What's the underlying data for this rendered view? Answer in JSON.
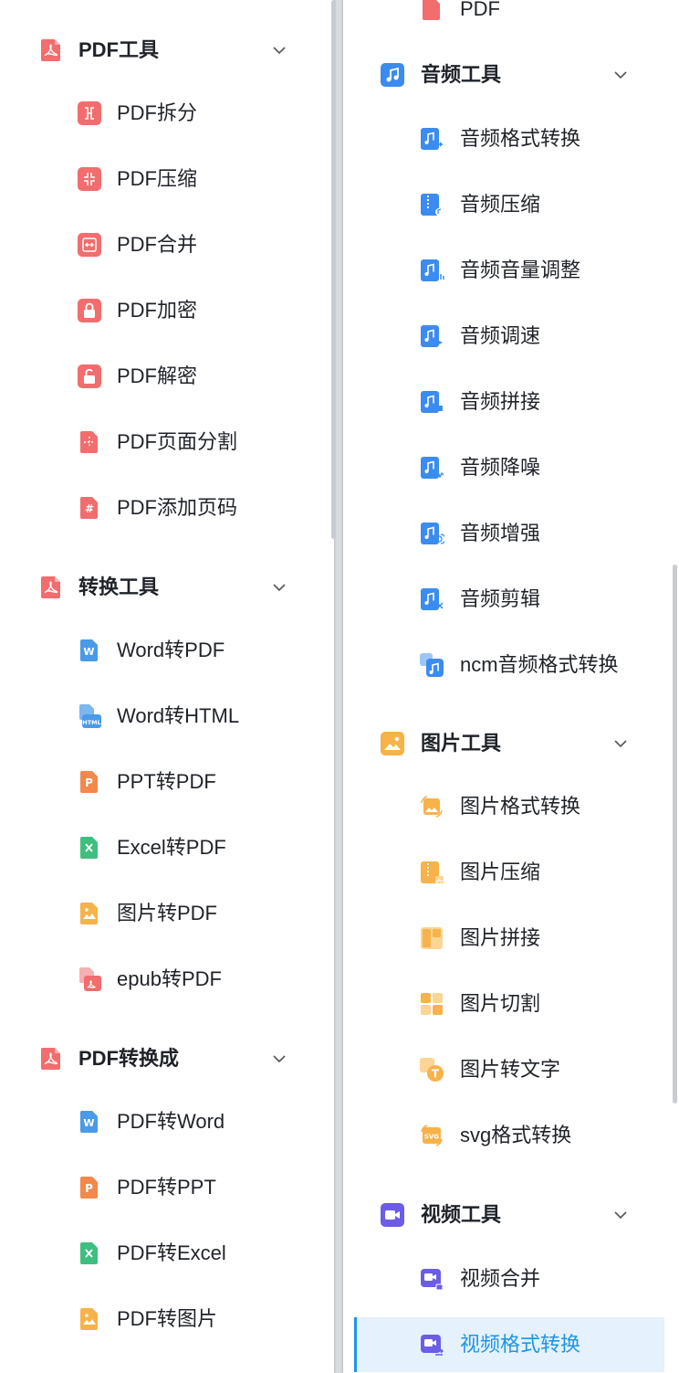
{
  "left_panel": {
    "groups": [
      {
        "title": "PDF工具",
        "icon": "pdf-icon",
        "items": [
          {
            "label": "PDF拆分",
            "icon": "pdf-split-icon"
          },
          {
            "label": "PDF压缩",
            "icon": "pdf-compress-icon"
          },
          {
            "label": "PDF合并",
            "icon": "pdf-merge-icon"
          },
          {
            "label": "PDF加密",
            "icon": "pdf-lock-icon"
          },
          {
            "label": "PDF解密",
            "icon": "pdf-unlock-icon"
          },
          {
            "label": "PDF页面分割",
            "icon": "pdf-page-split-icon"
          },
          {
            "label": "PDF添加页码",
            "icon": "pdf-page-number-icon"
          }
        ]
      },
      {
        "title": "转换工具",
        "icon": "convert-tools-icon",
        "items": [
          {
            "label": "Word转PDF",
            "icon": "word-doc-icon"
          },
          {
            "label": "Word转HTML",
            "icon": "word-html-icon"
          },
          {
            "label": "PPT转PDF",
            "icon": "ppt-doc-icon"
          },
          {
            "label": "Excel转PDF",
            "icon": "excel-doc-icon"
          },
          {
            "label": "图片转PDF",
            "icon": "image-doc-icon"
          },
          {
            "label": "epub转PDF",
            "icon": "epub-pdf-icon"
          }
        ]
      },
      {
        "title": "PDF转换成",
        "icon": "pdf-convert-icon",
        "items": [
          {
            "label": "PDF转Word",
            "icon": "word-doc-icon"
          },
          {
            "label": "PDF转PPT",
            "icon": "ppt-doc-icon"
          },
          {
            "label": "PDF转Excel",
            "icon": "excel-doc-icon"
          },
          {
            "label": "PDF转图片",
            "icon": "image-doc-icon"
          }
        ]
      }
    ]
  },
  "right_panel": {
    "cut_off_item": {
      "label": "PDF",
      "icon": "pdf-doc-icon"
    },
    "groups": [
      {
        "title": "音频工具",
        "icon": "music-note-icon",
        "items": [
          {
            "label": "音频格式转换",
            "icon": "audio-convert-icon"
          },
          {
            "label": "音频压缩",
            "icon": "audio-compress-icon"
          },
          {
            "label": "音频音量调整",
            "icon": "audio-volume-icon"
          },
          {
            "label": "音频调速",
            "icon": "audio-speed-icon"
          },
          {
            "label": "音频拼接",
            "icon": "audio-join-icon"
          },
          {
            "label": "音频降噪",
            "icon": "audio-denoise-icon"
          },
          {
            "label": "音频增强",
            "icon": "audio-enhance-icon"
          },
          {
            "label": "音频剪辑",
            "icon": "audio-cut-icon"
          },
          {
            "label": "ncm音频格式转换",
            "icon": "ncm-audio-icon"
          }
        ]
      },
      {
        "title": "图片工具",
        "icon": "picture-icon",
        "items": [
          {
            "label": "图片格式转换",
            "icon": "image-convert-icon"
          },
          {
            "label": "图片压缩",
            "icon": "image-compress-icon"
          },
          {
            "label": "图片拼接",
            "icon": "image-join-icon"
          },
          {
            "label": "图片切割",
            "icon": "image-cut-icon"
          },
          {
            "label": "图片转文字",
            "icon": "image-ocr-icon"
          },
          {
            "label": "svg格式转换",
            "icon": "svg-convert-icon"
          }
        ]
      },
      {
        "title": "视频工具",
        "icon": "video-camera-icon",
        "items": [
          {
            "label": "视频合并",
            "icon": "video-merge-icon"
          },
          {
            "label": "视频格式转换",
            "icon": "video-convert-icon",
            "active": true
          }
        ]
      }
    ]
  },
  "colors": {
    "pdf_red": "#f26d6d",
    "audio_blue": "#3b8cf0",
    "image_orange": "#f7b24a",
    "video_purple": "#6b5de6",
    "word_blue": "#4a9ae8",
    "ppt_orange": "#f2884a",
    "excel_green": "#3fbf7f",
    "active_text": "#1c96e8",
    "active_bg": "#e5f1fc"
  }
}
